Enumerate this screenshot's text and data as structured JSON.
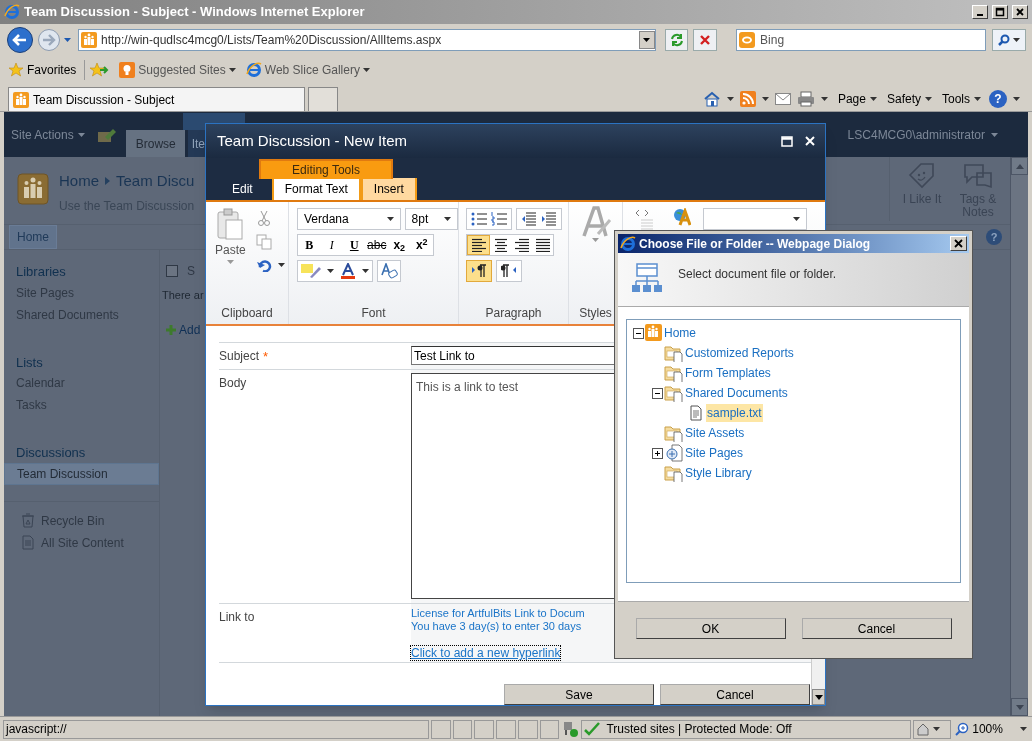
{
  "browser": {
    "title": "Team Discussion - Subject - Windows Internet Explorer",
    "address": "http://win-qudlsc4mcg0/Lists/Team%20Discussion/AllItems.aspx",
    "search": {
      "placeholder": "Bing"
    },
    "favorites": {
      "label": "Favorites",
      "links": [
        {
          "label": "Suggested Sites",
          "kind": "suggested"
        },
        {
          "label": "Web Slice Gallery",
          "kind": "webslice"
        }
      ]
    },
    "tabs": [
      {
        "label": "Team Discussion - Subject",
        "selected": true
      }
    ],
    "commands": [
      {
        "label": "Page"
      },
      {
        "label": "Safety"
      },
      {
        "label": "Tools"
      }
    ],
    "help_glyph": "?"
  },
  "site": {
    "site_actions": "Site Actions",
    "ribbon_tabs": [
      {
        "label": "Browse",
        "selected": true
      },
      {
        "label": "Ite",
        "selected": false
      }
    ],
    "user": "LSC4MCG0\\administrator",
    "social": [
      {
        "label": "I Like It",
        "kind": "like"
      },
      {
        "label": "Tags & Notes",
        "kind": "tags"
      }
    ],
    "breadcrumb": [
      "Home",
      "Team Discu"
    ],
    "description": "Use the Team Discussion",
    "top_nav": [
      {
        "label": "Home",
        "selected": true
      }
    ],
    "help_glyph": "?",
    "quick_launch": [
      {
        "heading": "Libraries",
        "items": [
          {
            "label": "Site Pages",
            "selected": false
          },
          {
            "label": "Shared Documents",
            "selected": false
          }
        ]
      },
      {
        "heading": "Lists",
        "items": [
          {
            "label": "Calendar",
            "selected": false
          },
          {
            "label": "Tasks",
            "selected": false
          }
        ]
      },
      {
        "heading": "Discussions",
        "items": [
          {
            "label": "Team Discussion",
            "selected": true
          }
        ]
      }
    ],
    "footer_links": [
      {
        "label": "Recycle Bin",
        "kind": "recycle"
      },
      {
        "label": "All Site Content",
        "kind": "content"
      }
    ],
    "list": {
      "select_all": {
        "checked": false
      },
      "column_1": "S",
      "message": "There ar",
      "add_link": "Add"
    }
  },
  "new_item": {
    "title": "Team Discussion - New Item",
    "context_label": "Editing Tools",
    "tabs": [
      {
        "label": "Edit",
        "selected": false,
        "contextual": false
      },
      {
        "label": "Format Text",
        "selected": true,
        "contextual": true
      },
      {
        "label": "Insert",
        "selected": false,
        "contextual": true
      }
    ],
    "clipboard": {
      "label": "Clipboard",
      "paste": "Paste"
    },
    "font": {
      "label": "Font",
      "face": "Verdana",
      "size": "8pt",
      "buttons": [
        {
          "label": "B",
          "kind": "bold"
        },
        {
          "label": "I",
          "kind": "italic"
        },
        {
          "label": "U",
          "kind": "underline"
        },
        {
          "label": "abc",
          "kind": "strike"
        },
        {
          "label": "x$_{2}$",
          "kind": "sub"
        },
        {
          "label": "x$^{2}$",
          "kind": "sup"
        }
      ]
    },
    "paragraph": {
      "label": "Paragraph",
      "alignment": [
        {
          "kind": "left",
          "selected": true
        },
        {
          "kind": "center",
          "selected": false
        },
        {
          "kind": "right",
          "selected": false
        },
        {
          "kind": "justify",
          "selected": false
        }
      ],
      "direction": [
        {
          "kind": "ltr",
          "selected": true
        },
        {
          "kind": "rtl",
          "selected": false
        }
      ]
    },
    "styles": {
      "label": "Styles"
    },
    "fields": [
      {
        "label": "Subject",
        "required_mark": "*",
        "kind": "text",
        "value": "Test Link to"
      },
      {
        "label": "Body",
        "kind": "textarea",
        "value": "This is a link to test"
      },
      {
        "label": "Link to",
        "kind": "links",
        "lines": [
          "License for ArtfulBits Link to Docum",
          "You have 3 day(s) to enter 30 days"
        ],
        "link": "Click to add a new hyperlink"
      }
    ],
    "buttons": [
      {
        "label": "Save"
      },
      {
        "label": "Cancel"
      }
    ]
  },
  "file_dialog": {
    "title": "Choose File or Folder -- Webpage Dialog",
    "instruction": "Select document file or folder.",
    "tree": [
      {
        "label": "Home",
        "kind": "site",
        "expanded": true,
        "selected": false,
        "children": [
          {
            "label": "Customized Reports",
            "kind": "folder",
            "selected": false
          },
          {
            "label": "Form Templates",
            "kind": "folder",
            "selected": false
          },
          {
            "label": "Shared Documents",
            "kind": "folder",
            "expanded": true,
            "selected": false,
            "children": [
              {
                "label": "sample.txt",
                "kind": "file",
                "selected": true
              }
            ]
          },
          {
            "label": "Site Assets",
            "kind": "folder",
            "selected": false
          },
          {
            "label": "Site Pages",
            "kind": "pages",
            "expanded": false,
            "selected": false
          },
          {
            "label": "Style Library",
            "kind": "folder",
            "selected": false
          }
        ]
      }
    ],
    "buttons": [
      {
        "label": "OK"
      },
      {
        "label": "Cancel"
      }
    ]
  },
  "status_bar": {
    "text": "javascript://",
    "zone": "Trusted sites | Protected Mode: Off",
    "zoom": "100%"
  }
}
